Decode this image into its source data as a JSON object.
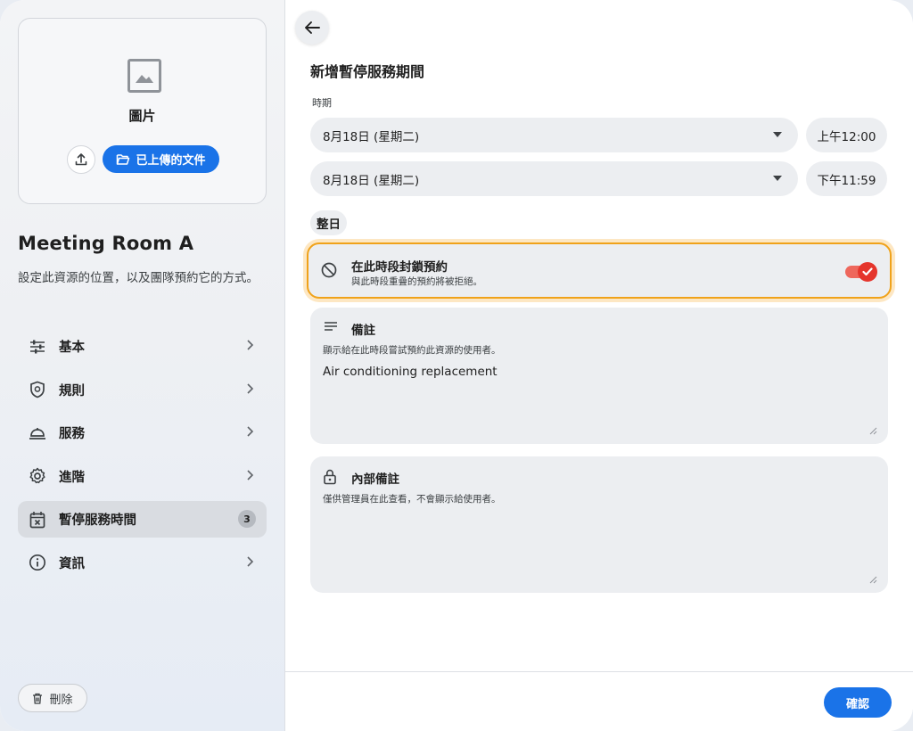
{
  "image_card": {
    "label": "圖片",
    "upload_icon": "upload-icon",
    "uploaded_docs_label": "已上傳的文件"
  },
  "resource": {
    "name": "Meeting Room A",
    "description": "設定此資源的位置，以及團隊預約它的方式。"
  },
  "nav": {
    "items": [
      {
        "label": "基本",
        "icon": "sliders-icon"
      },
      {
        "label": "規則",
        "icon": "shield-icon"
      },
      {
        "label": "服務",
        "icon": "service-bell-icon"
      },
      {
        "label": "進階",
        "icon": "gear-icon"
      },
      {
        "label": "暫停服務時間",
        "icon": "calendar-x-icon",
        "badge": "3",
        "active": true
      },
      {
        "label": "資訊",
        "icon": "info-icon"
      }
    ]
  },
  "delete_label": "刪除",
  "form": {
    "title": "新增暫停服務期間",
    "period_label": "時期",
    "start_date": "8月18日 (星期二)",
    "start_time": "上午12:00",
    "end_date": "8月18日 (星期二)",
    "end_time": "下午11:59",
    "all_day_label": "整日",
    "block": {
      "title": "在此時段封鎖預約",
      "subtitle": "與此時段重疊的預約將被拒絕。",
      "enabled": true
    },
    "notes": {
      "title": "備註",
      "subtitle": "顯示給在此時段嘗試預約此資源的使用者。",
      "value": "Air conditioning replacement"
    },
    "internal_notes": {
      "title": "內部備註",
      "subtitle": "僅供管理員在此查看，不會顯示給使用者。",
      "value": ""
    }
  },
  "confirm_label": "確認",
  "colors": {
    "accent": "#1a73e8",
    "toggle_on": "#e5352c",
    "highlight_border": "#f0a21a"
  }
}
